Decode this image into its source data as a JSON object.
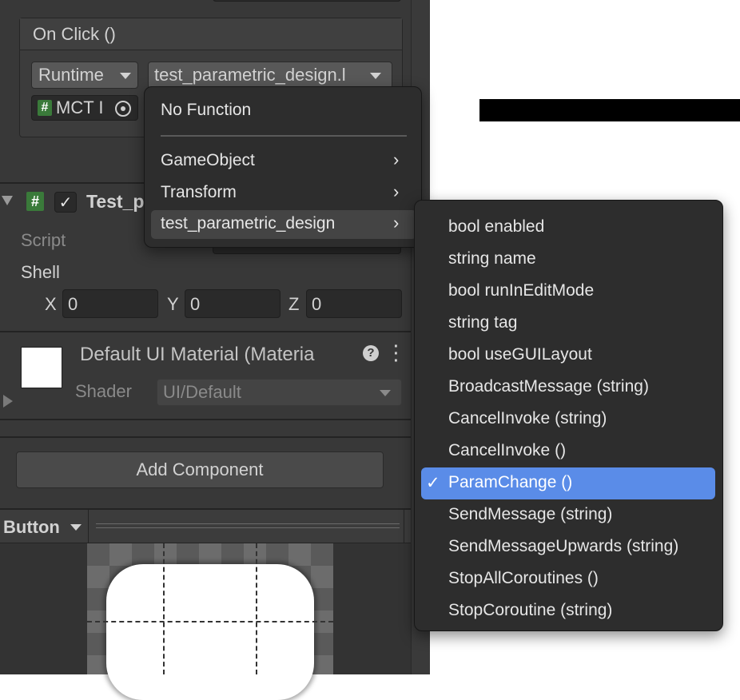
{
  "event": {
    "title": "On Click ()",
    "runtime_label": "Runtime",
    "target_label": "test_parametric_design.l",
    "object_label": "MCT I",
    "object_badge": "#"
  },
  "component": {
    "title": "Test_p",
    "badge": "#",
    "script_label": "Script",
    "shell_label": "Shell",
    "x_label": "X",
    "x_value": "0",
    "y_label": "Y",
    "y_value": "0",
    "z_label": "Z",
    "z_value": "0"
  },
  "material": {
    "name": "Default UI Material (Materia",
    "shader_label": "Shader",
    "shader_value": "UI/Default"
  },
  "add_component_label": "Add Component",
  "preview": {
    "dropdown_label": "Button"
  },
  "function_menu": {
    "no_function": "No Function",
    "items": [
      "GameObject",
      "Transform",
      "test_parametric_design"
    ]
  },
  "submenu": {
    "items": [
      "bool enabled",
      "string name",
      "bool runInEditMode",
      "string tag",
      "bool useGUILayout",
      "BroadcastMessage (string)",
      "CancelInvoke (string)",
      "CancelInvoke ()",
      "ParamChange ()",
      "SendMessage (string)",
      "SendMessageUpwards (string)",
      "StopAllCoroutines ()",
      "StopCoroutine (string)"
    ],
    "selected": "ParamChange ()"
  },
  "colors": {
    "selection": "#5a8ce8",
    "inspector_bg": "#383838",
    "menu_bg": "#2d2d2d"
  }
}
